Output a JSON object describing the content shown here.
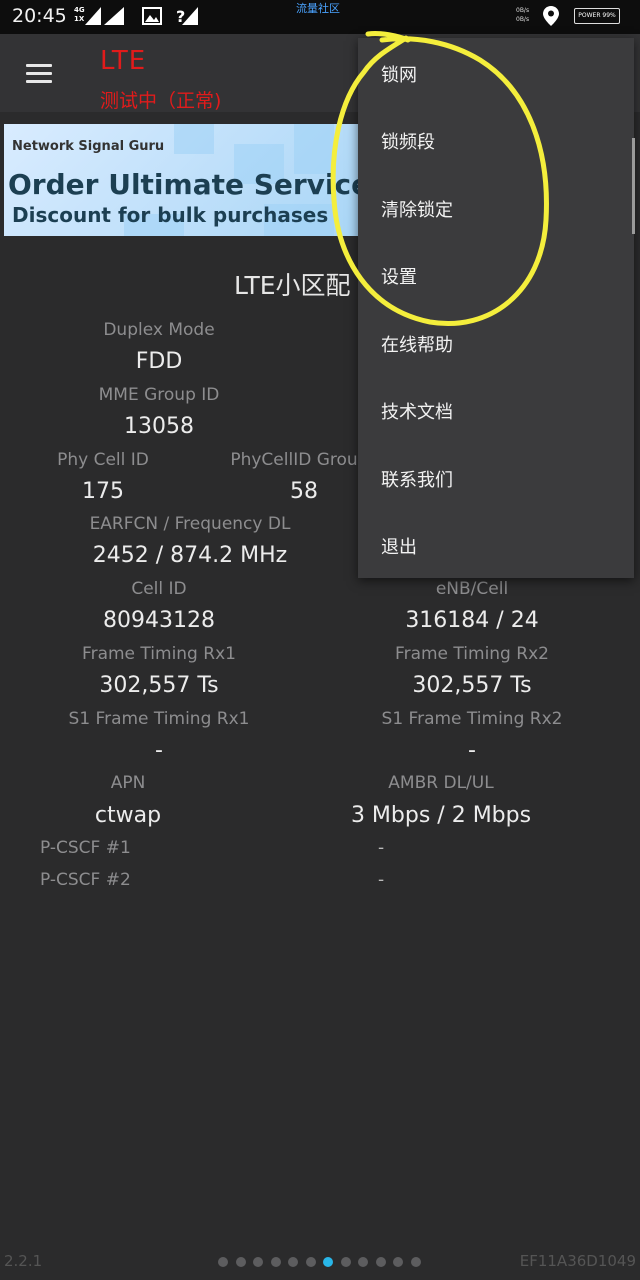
{
  "status_bar": {
    "time": "20:45",
    "network_top": "4G",
    "network_bottom": "1X",
    "watermark": "流量社区",
    "speed_up": "0B/s",
    "speed_down": "0B/s",
    "battery": "POWER 99%"
  },
  "toolbar": {
    "title": "LTE",
    "subtitle": "测试中（正常)"
  },
  "ad": {
    "brand": "Network Signal Guru",
    "headline": "Order Ultimate Service",
    "tagline": "Discount for bulk purchases"
  },
  "section_title": "LTE小区配",
  "fields": {
    "duplex_mode": {
      "label": "Duplex Mode",
      "value": "FDD"
    },
    "mme_group_id": {
      "label": "MME Group ID",
      "value": "13058"
    },
    "phy_cell_id": {
      "label": "Phy Cell ID",
      "value": "175"
    },
    "phycellid_group": {
      "label": "PhyCellID Grou",
      "value": "58"
    },
    "earfcn": {
      "label": "EARFCN / Frequency DL",
      "value": "2452 / 874.2 MHz"
    },
    "cell_id": {
      "label": "Cell ID",
      "value": "80943128"
    },
    "enb_cell": {
      "label": "eNB/Cell",
      "value": "316184 / 24"
    },
    "frame_timing_rx1": {
      "label": "Frame Timing Rx1",
      "value": "302,557 Ts"
    },
    "frame_timing_rx2": {
      "label": "Frame Timing Rx2",
      "value": "302,557 Ts"
    },
    "s1_frame_timing_rx1": {
      "label": "S1 Frame Timing Rx1",
      "value": "-"
    },
    "s1_frame_timing_rx2": {
      "label": "S1 Frame Timing Rx2",
      "value": "-"
    },
    "apn": {
      "label": "APN",
      "value": "ctwap"
    },
    "ambr": {
      "label": "AMBR DL/UL",
      "value": "3 Mbps / 2 Mbps"
    },
    "pcscf1": {
      "label": "P-CSCF #1",
      "value": "-"
    },
    "pcscf2": {
      "label": "P-CSCF #2",
      "value": "-"
    }
  },
  "menu": {
    "items": [
      "锁网",
      "锁频段",
      "清除锁定",
      "设置",
      "在线帮助",
      "技术文档",
      "联系我们",
      "退出"
    ]
  },
  "footer": {
    "version": "2.2.1",
    "device_id": "EF11A36D1049",
    "page_count": 12,
    "active_page_index": 6
  },
  "colors": {
    "background": "#2b2b2c",
    "toolbar": "#333335",
    "status_red": "#e11b1b",
    "menu_bg": "#3b3b3d",
    "accent_dot": "#29b6e8",
    "annotation": "#f4ee3c"
  },
  "icons": [
    "menu-icon",
    "signal-icon",
    "image-icon",
    "signal-alert-icon",
    "location-icon",
    "battery-icon"
  ]
}
